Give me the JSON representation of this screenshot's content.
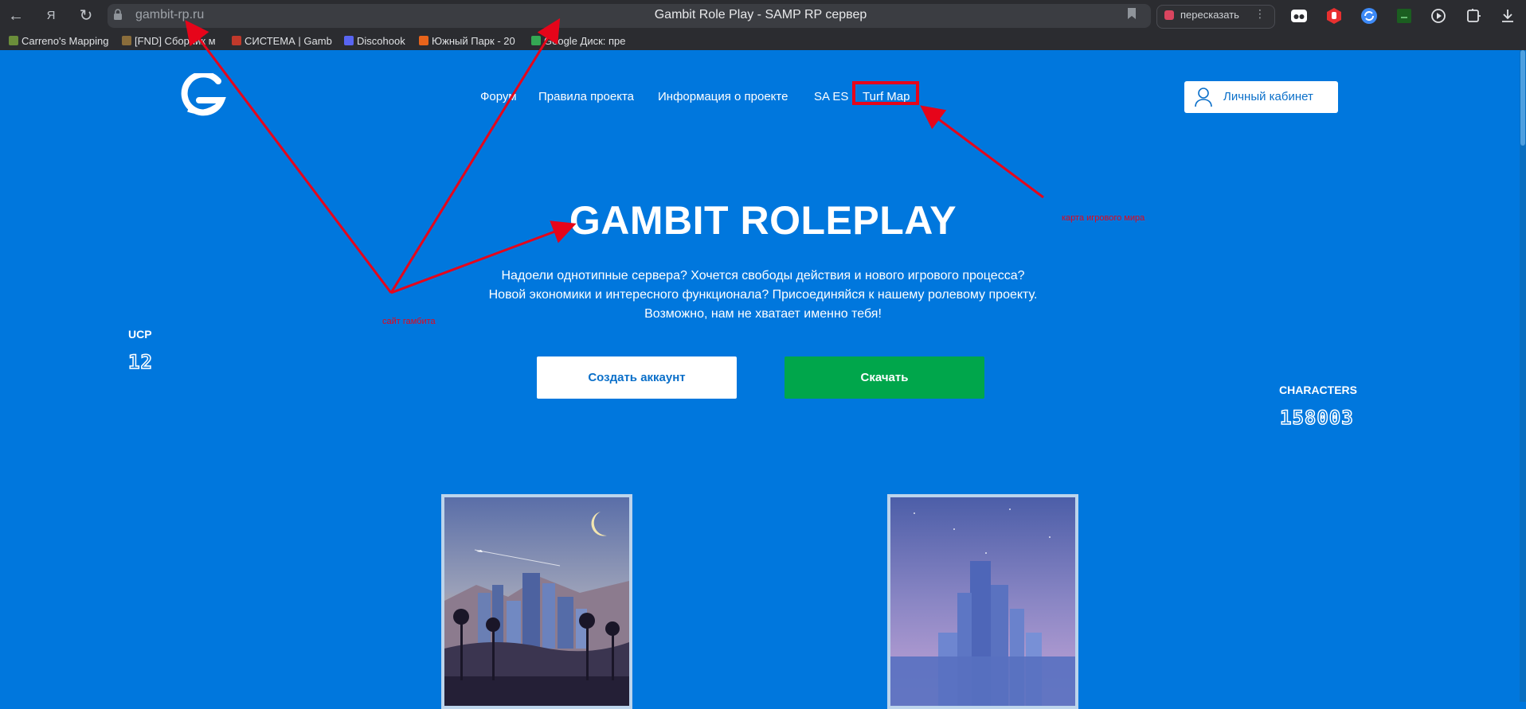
{
  "browser": {
    "url": "gambit-rp.ru",
    "tab_title": "Gambit Role Play - SAMP RP сервер",
    "retell_label": "пересказать",
    "bookmarks": [
      {
        "label": "Carreno's Mapping",
        "color": "#6b8e3a"
      },
      {
        "label": "[FND] Сборник м",
        "color": "#8a6d3b"
      },
      {
        "label": "СИСТЕМА | Gamb",
        "color": "#c0392b"
      },
      {
        "label": "Discohook",
        "color": "#5865f2"
      },
      {
        "label": "Южный Парк - 20",
        "color": "#e8641b"
      },
      {
        "label": "Google Диск: пре",
        "color": "#34a853"
      }
    ],
    "extensions": [
      {
        "icon": "mask-icon",
        "color": "#ffffff"
      },
      {
        "icon": "hand-stop-icon",
        "color": "#e8302f"
      },
      {
        "icon": "sync-icon",
        "color": "#3d8af7"
      },
      {
        "icon": "sheet-icon",
        "color": "#1b5e20"
      },
      {
        "icon": "play-icon",
        "color": "#dfe1e4"
      },
      {
        "icon": "puzzle-icon",
        "color": "#dfe1e4"
      },
      {
        "icon": "download-icon",
        "color": "#dfe1e4"
      }
    ]
  },
  "page": {
    "nav": [
      "Форум",
      "Правила проекта",
      "Информация о проекте",
      "SA ES",
      "Turf Map"
    ],
    "cabinet_label": "Личный кабинет",
    "hero_title": "GAMBIT ROLEPLAY",
    "hero_lines": [
      "Надоели однотипные сервера? Хочется свободы действия и нового игрового процесса?",
      "Новой экономики и интересного функционала? Присоединяйся к нашему ролевому проекту.",
      "Возможно, нам не хватает именно тебя!"
    ],
    "btn_create": "Создать аккаунт",
    "btn_download": "Скачать",
    "ucp_label": "UCP",
    "ucp_value": "12",
    "characters_label": "CHARACTERS",
    "characters_value": "158003"
  },
  "annotations": {
    "left_note": "сайт гамбита",
    "right_note": "карта игрового мира"
  },
  "colors": {
    "page_bg": "#0077dd",
    "accent_green": "#00a64b",
    "annotation_red": "#e6051a"
  }
}
